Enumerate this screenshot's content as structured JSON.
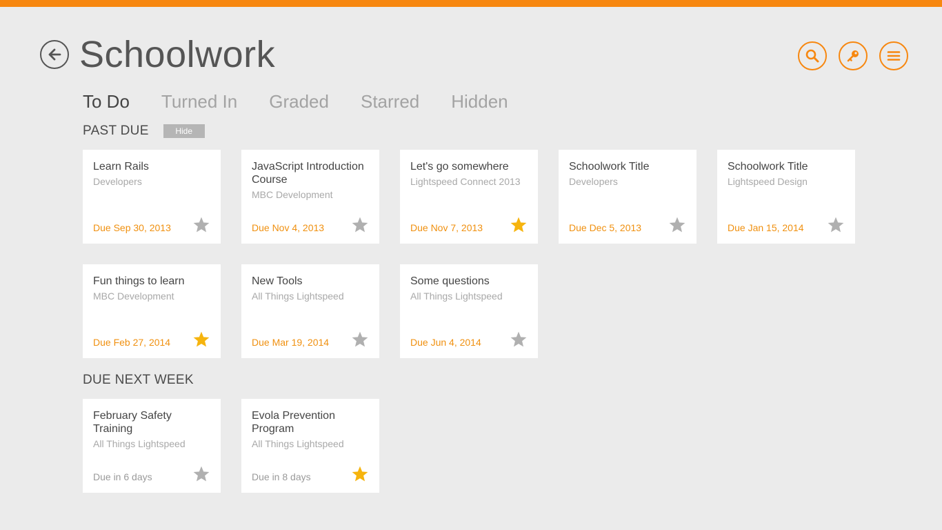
{
  "header": {
    "title": "Schoolwork",
    "actions": [
      {
        "name": "search-button",
        "icon": "search-icon"
      },
      {
        "name": "key-button",
        "icon": "key-icon"
      },
      {
        "name": "menu-button",
        "icon": "menu-icon"
      }
    ]
  },
  "colors": {
    "accent": "#f7870f",
    "star_on": "#f6b40e",
    "star_off": "#b0b0b0",
    "due": "#f0900f"
  },
  "tabs": [
    {
      "label": "To Do",
      "active": true
    },
    {
      "label": "Turned In",
      "active": false
    },
    {
      "label": "Graded",
      "active": false
    },
    {
      "label": "Starred",
      "active": false
    },
    {
      "label": "Hidden",
      "active": false
    }
  ],
  "sections": [
    {
      "title": "PAST DUE",
      "hide_label": "Hide",
      "cards": [
        {
          "title": "Learn Rails",
          "subtitle": "Developers",
          "due": "Due Sep 30, 2013",
          "starred": false
        },
        {
          "title": "JavaScript Introduction Course",
          "subtitle": "MBC Development",
          "due": "Due Nov 4, 2013",
          "starred": false
        },
        {
          "title": "Let's go somewhere",
          "subtitle": "Lightspeed Connect 2013",
          "due": "Due Nov 7, 2013",
          "starred": true
        },
        {
          "title": "Schoolwork Title",
          "subtitle": "Developers",
          "due": "Due Dec 5, 2013",
          "starred": false
        },
        {
          "title": "Schoolwork Title",
          "subtitle": "Lightspeed Design",
          "due": "Due Jan 15, 2014",
          "starred": false
        },
        {
          "title": "Fun things to learn",
          "subtitle": "MBC Development",
          "due": "Due Feb 27, 2014",
          "starred": true
        },
        {
          "title": "New Tools",
          "subtitle": "All Things Lightspeed",
          "due": "Due Mar 19, 2014",
          "starred": false
        },
        {
          "title": "Some questions",
          "subtitle": "All Things Lightspeed",
          "due": "Due Jun 4, 2014",
          "starred": false
        }
      ]
    },
    {
      "title": "DUE NEXT WEEK",
      "cards": [
        {
          "title": "February Safety Training",
          "subtitle": "All Things Lightspeed",
          "due": "Due in 6 days",
          "starred": false
        },
        {
          "title": "Evola Prevention Program",
          "subtitle": "All Things Lightspeed",
          "due": "Due in 8 days",
          "starred": true
        }
      ]
    }
  ]
}
